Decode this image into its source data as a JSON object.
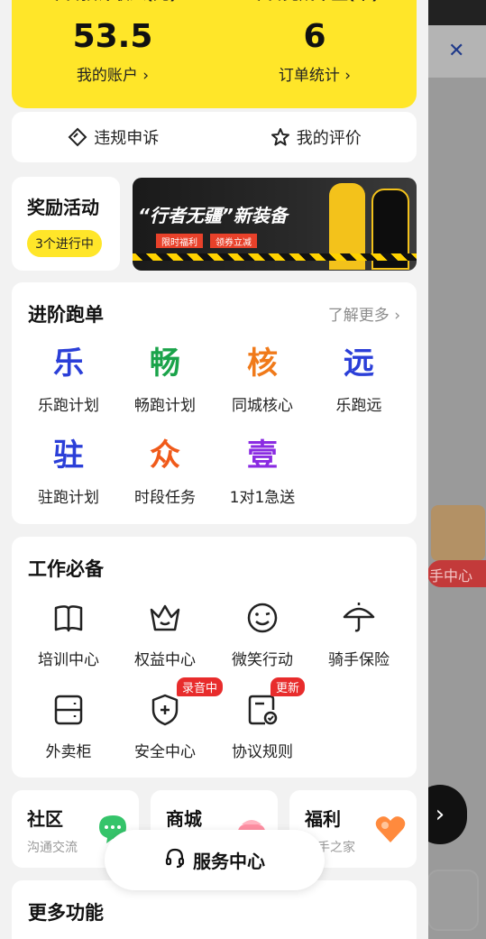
{
  "income": {
    "left_caption": "今日预计收入(元)",
    "left_value": "53.5",
    "left_link": "我的账户 ›",
    "right_caption": "今日完成单量(单)",
    "right_value": "6",
    "right_link": "订单统计 ›",
    "accent": "#ffe629"
  },
  "quick_links": {
    "appeal": "违规申诉",
    "review": "我的评价"
  },
  "reward": {
    "title": "奖励活动",
    "badge": "3个进行中"
  },
  "banner": {
    "headline": "“行者无疆”新装备",
    "tag1": "限时福利",
    "tag2": "领券立减"
  },
  "advanced": {
    "title": "进阶跑单",
    "more": "了解更多 ›",
    "items": [
      {
        "glyph": "乐",
        "label": "乐跑计划",
        "color": "#2b3fd8"
      },
      {
        "glyph": "畅",
        "label": "畅跑计划",
        "color": "#1aa34a"
      },
      {
        "glyph": "核",
        "label": "同城核心",
        "color": "#f07a1a"
      },
      {
        "glyph": "远",
        "label": "乐跑远",
        "color": "#2b3fd8"
      },
      {
        "glyph": "驻",
        "label": "驻跑计划",
        "color": "#2b3fd8"
      },
      {
        "glyph": "众",
        "label": "时段任务",
        "color": "#f05a1a"
      },
      {
        "glyph": "壹",
        "label": "1对1急送",
        "color": "#8a2be2"
      }
    ]
  },
  "essentials": {
    "title": "工作必备",
    "items": [
      {
        "label": "培训中心",
        "icon": "book-icon"
      },
      {
        "label": "权益中心",
        "icon": "crown-icon"
      },
      {
        "label": "微笑行动",
        "icon": "smile-icon"
      },
      {
        "label": "骑手保险",
        "icon": "umbrella-icon"
      },
      {
        "label": "外卖柜",
        "icon": "locker-icon"
      },
      {
        "label": "安全中心",
        "icon": "shield-icon",
        "badge": "录音中"
      },
      {
        "label": "协议规则",
        "icon": "document-icon",
        "badge": "更新"
      }
    ]
  },
  "mini_cards": [
    {
      "title": "社区",
      "subtitle": "沟通交流"
    },
    {
      "title": "商城",
      "subtitle": ""
    },
    {
      "title": "福利",
      "subtitle": "骑手之家"
    }
  ],
  "service_button": "服务中心",
  "more_features": "更多功能",
  "background": {
    "side_pill": "手中心"
  }
}
